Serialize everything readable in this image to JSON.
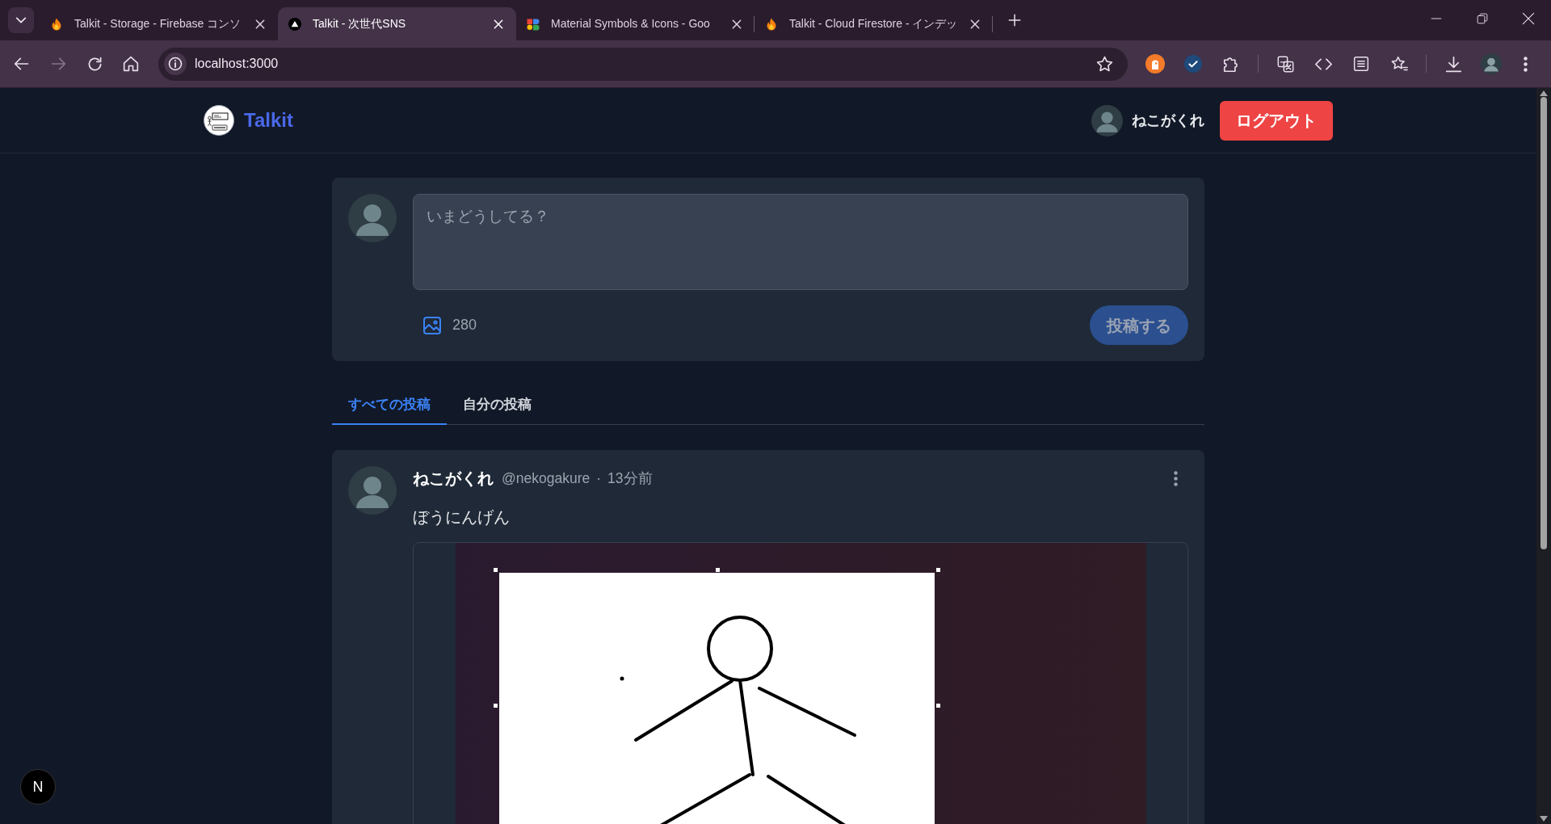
{
  "browser": {
    "tabs": [
      {
        "title": "Talkit - Storage - Firebase コンソ",
        "kind": "flame",
        "selected": false
      },
      {
        "title": "Talkit - 次世代SNS",
        "kind": "triangle",
        "selected": true
      },
      {
        "title": "Material Symbols & Icons - Goo",
        "kind": "blocks",
        "selected": false
      },
      {
        "title": "Talkit - Cloud Firestore - インデッ",
        "kind": "flame",
        "selected": false
      }
    ],
    "nav": {
      "back_disabled": false,
      "forward_disabled": true
    },
    "url": "localhost:3000"
  },
  "header": {
    "logo_text": "Talkit",
    "user_name": "ねこがくれ",
    "logout_label": "ログアウト"
  },
  "composer": {
    "placeholder": "いまどうしてる？",
    "char_count": "280",
    "submit_label": "投稿する",
    "submit_disabled": true
  },
  "feed_tabs": [
    {
      "label": "すべての投稿",
      "selected": true
    },
    {
      "label": "自分の投稿",
      "selected": false
    }
  ],
  "posts": [
    {
      "display_name": "ねこがくれ",
      "handle": "@nekogakure",
      "separator": "·",
      "time": "13分前",
      "text": "ぼうにんげん",
      "has_image": true
    }
  ],
  "dev_indicator": {
    "label": "N"
  }
}
